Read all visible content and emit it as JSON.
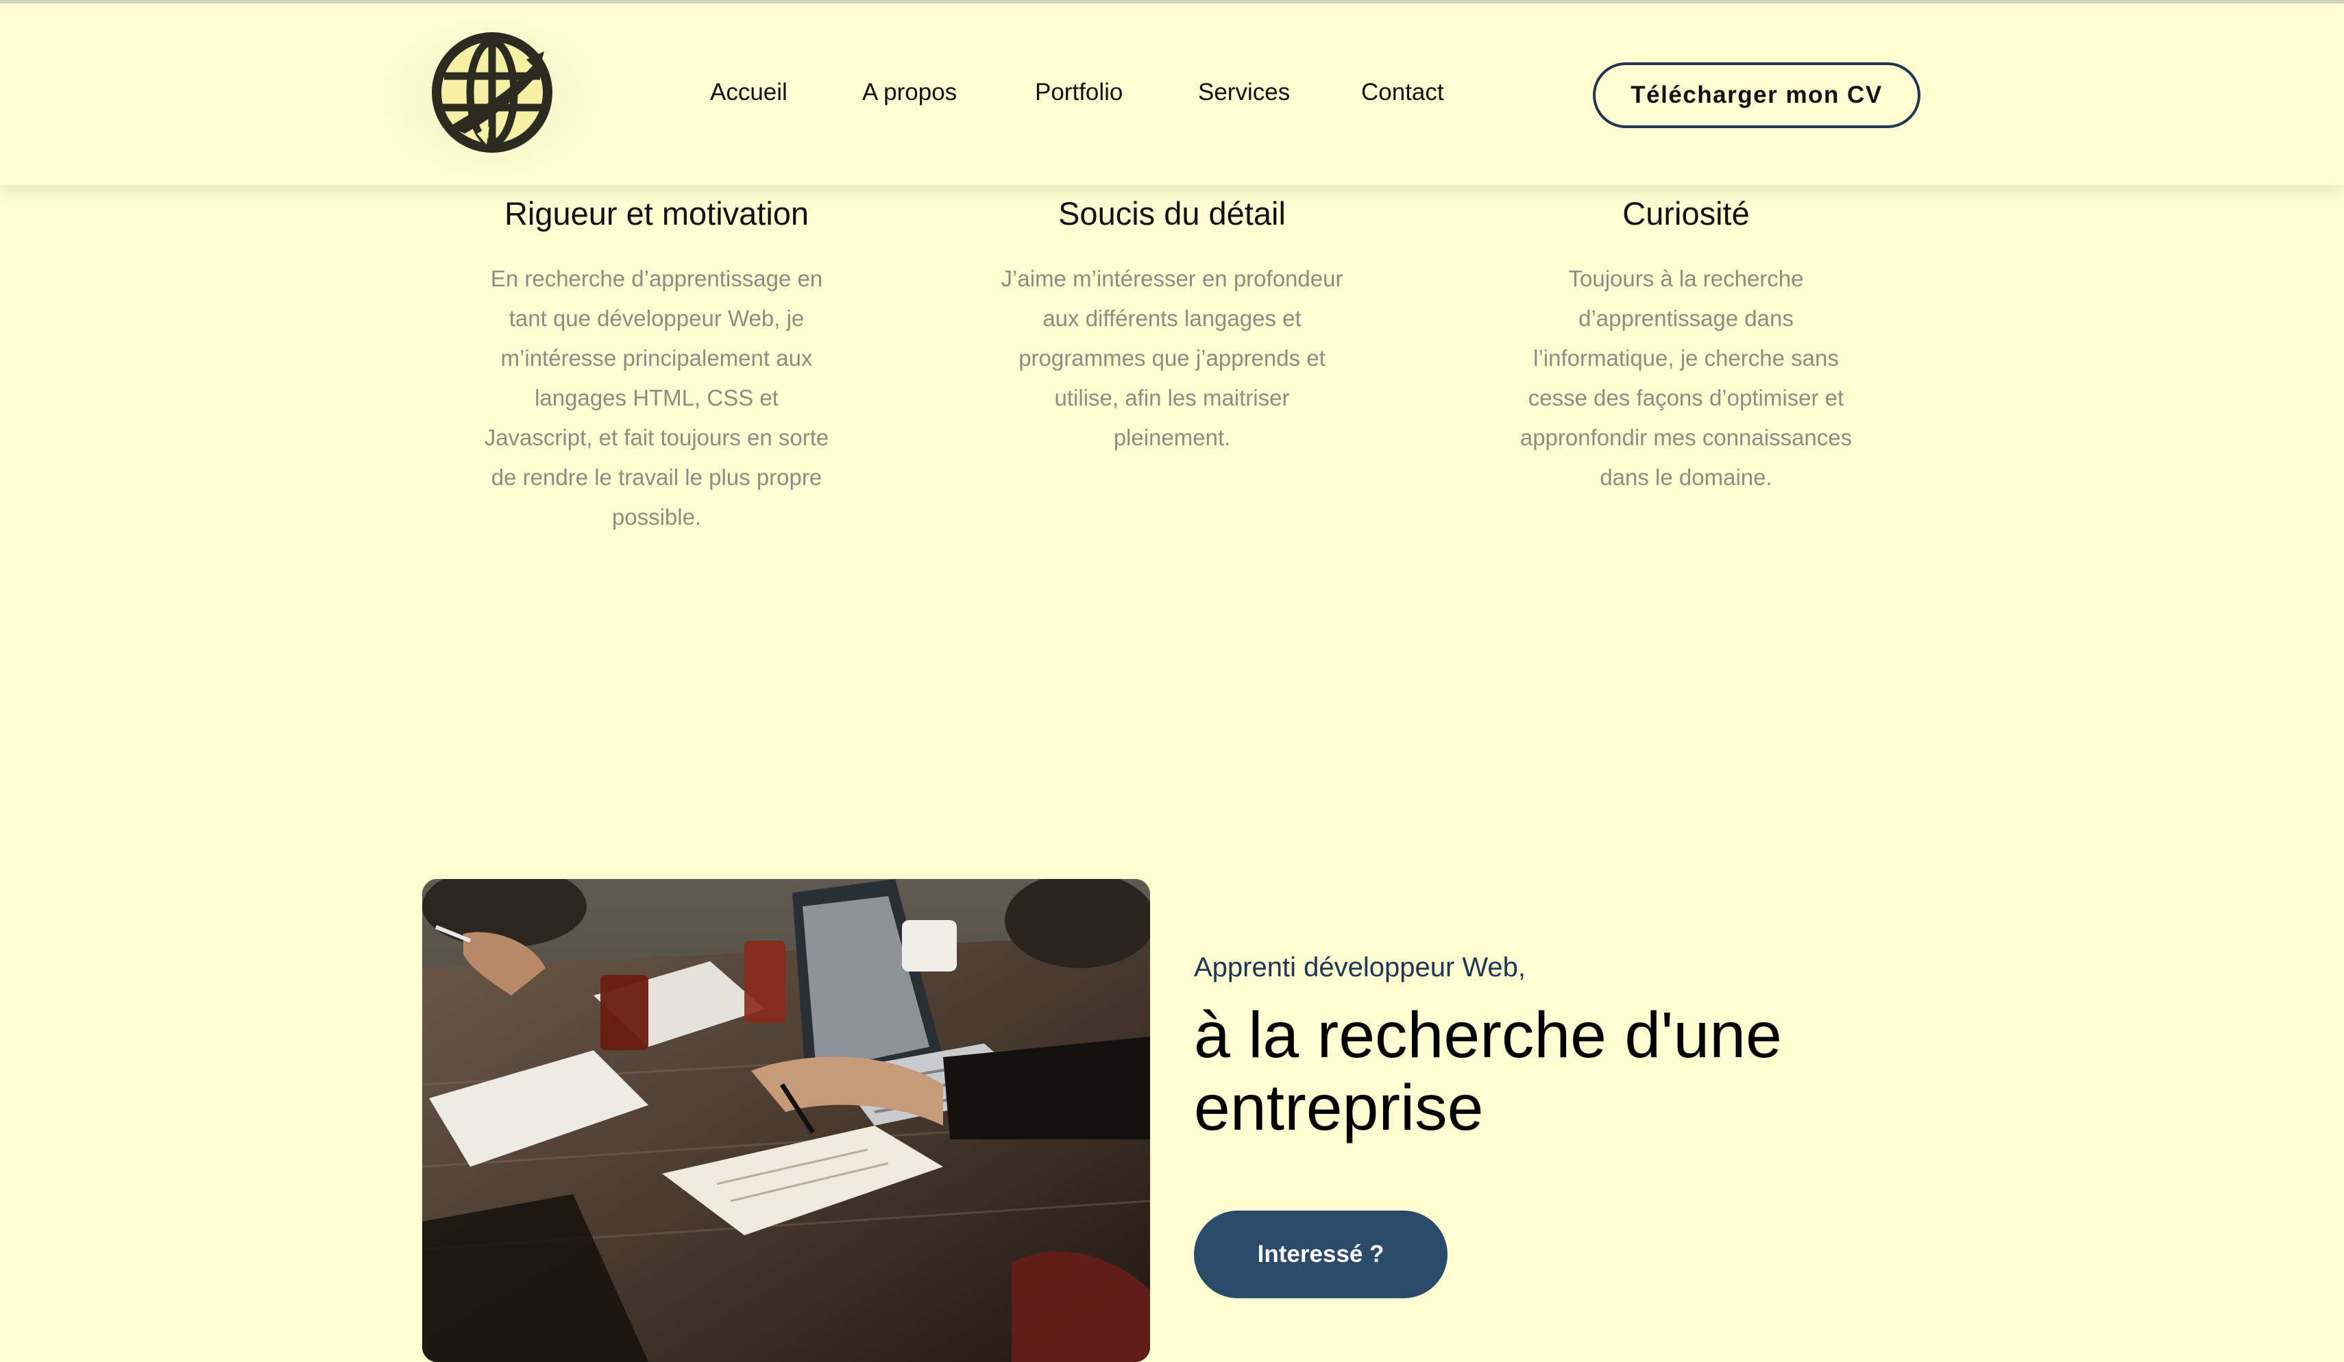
{
  "nav": {
    "items": [
      {
        "label": "Accueil"
      },
      {
        "label": "A propos"
      },
      {
        "label": "Portfolio"
      },
      {
        "label": "Services"
      },
      {
        "label": "Contact"
      }
    ],
    "cv_button": "Télécharger mon CV"
  },
  "logo": {
    "icon": "globe-plane-icon"
  },
  "features": [
    {
      "title": "Rigueur et motivation",
      "lines": [
        "En recherche d’apprentissage en",
        "tant que développeur Web, je",
        "m’intéresse principalement aux",
        "langages HTML, CSS et",
        "Javascript, et fait toujours en sorte",
        "de rendre le travail le plus propre",
        "possible."
      ]
    },
    {
      "title": "Soucis du détail",
      "lines": [
        "J’aime m’intéresser en profondeur",
        "aux différents langages et",
        "programmes que j’apprends et",
        "utilise, afin les maitriser",
        "pleinement."
      ]
    },
    {
      "title": "Curiosité",
      "lines": [
        "Toujours à la recherche",
        "d’apprentissage dans",
        "l’informatique, je cherche sans",
        "cesse des façons d’optimiser et",
        "appronfondir mes connaissances",
        "dans le domaine."
      ]
    }
  ],
  "cta_section": {
    "kicker": "Apprenti développeur Web,",
    "headline_line1": "à la recherche d'une",
    "headline_line2": "entreprise",
    "button": "Interessé ?"
  },
  "colors": {
    "background": "#fefed2",
    "accent_navy": "#1f3552",
    "button_blue": "#2c4a6a",
    "muted_text": "#8d8d84"
  }
}
